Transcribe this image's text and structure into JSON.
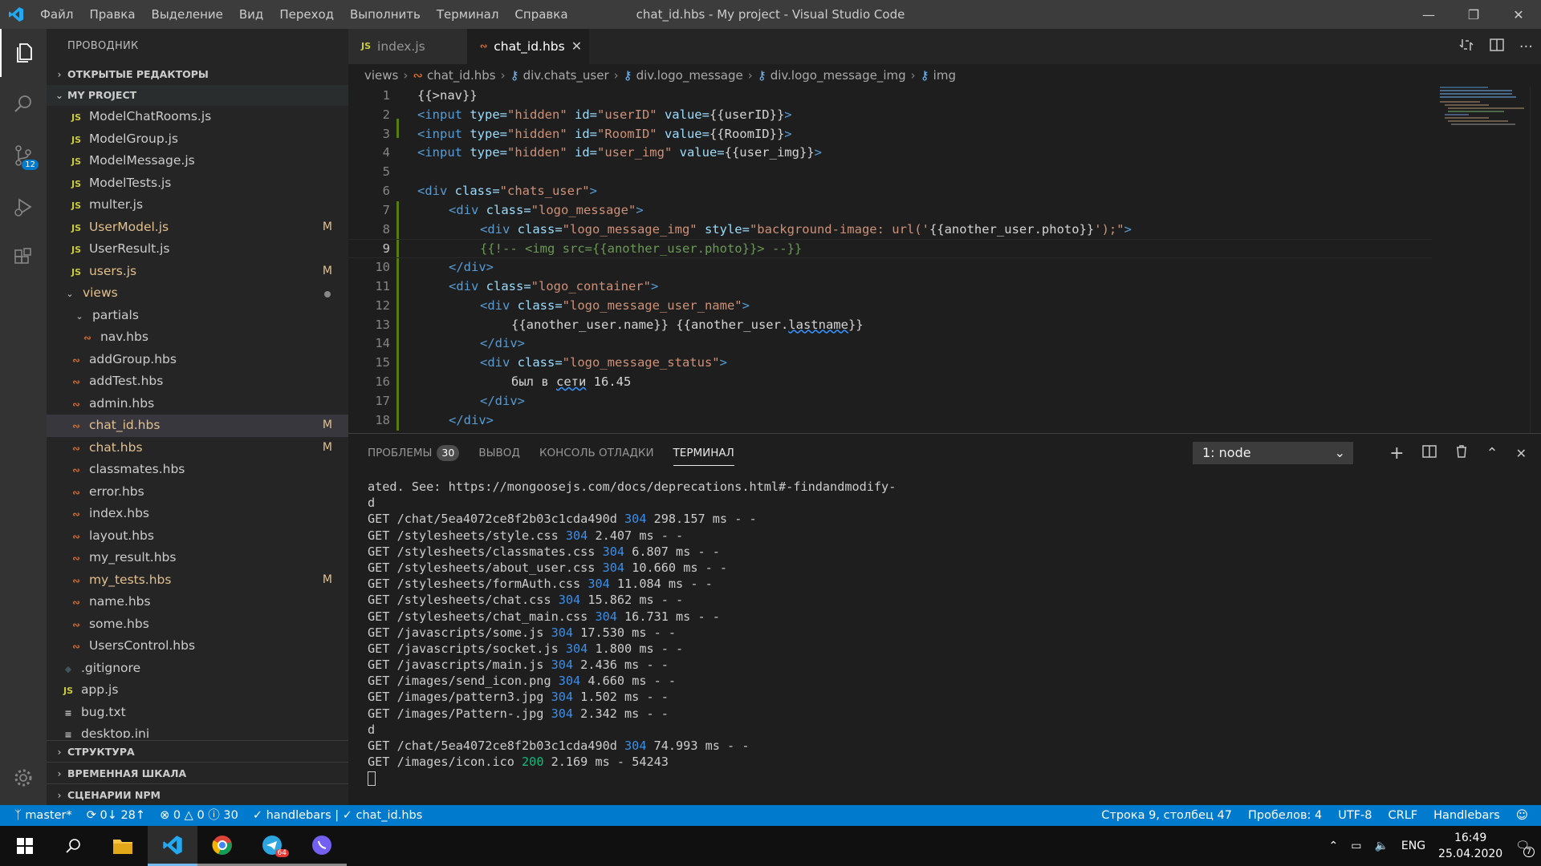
{
  "titlebar": {
    "menu": [
      "Файл",
      "Правка",
      "Выделение",
      "Вид",
      "Переход",
      "Выполнить",
      "Терминал",
      "Справка"
    ],
    "title": "chat_id.hbs - My project - Visual Studio Code"
  },
  "activitybar": {
    "scm_badge": "12"
  },
  "sidebar": {
    "title": "ПРОВОДНИК",
    "open_editors": "ОТКРЫТЫЕ РЕДАКТОРЫ",
    "project": "MY PROJECT",
    "files": [
      {
        "name": "ModelChatRooms.js",
        "icon": "JS",
        "flag": ""
      },
      {
        "name": "ModelGroup.js",
        "icon": "JS",
        "flag": ""
      },
      {
        "name": "ModelMessage.js",
        "icon": "JS",
        "flag": ""
      },
      {
        "name": "ModelTests.js",
        "icon": "JS",
        "flag": ""
      },
      {
        "name": "multer.js",
        "icon": "JS",
        "flag": ""
      },
      {
        "name": "UserModel.js",
        "icon": "JS",
        "flag": "M"
      },
      {
        "name": "UserResult.js",
        "icon": "JS",
        "flag": ""
      },
      {
        "name": "users.js",
        "icon": "JS",
        "flag": "M"
      },
      {
        "name": "views",
        "icon": "",
        "flag": ""
      },
      {
        "name": "partials",
        "icon": "",
        "flag": ""
      },
      {
        "name": "nav.hbs",
        "icon": "",
        "flag": ""
      },
      {
        "name": "addGroup.hbs",
        "icon": "",
        "flag": ""
      },
      {
        "name": "addTest.hbs",
        "icon": "",
        "flag": ""
      },
      {
        "name": "admin.hbs",
        "icon": "",
        "flag": ""
      },
      {
        "name": "chat_id.hbs",
        "icon": "",
        "flag": "M"
      },
      {
        "name": "chat.hbs",
        "icon": "",
        "flag": "M"
      },
      {
        "name": "classmates.hbs",
        "icon": "",
        "flag": ""
      },
      {
        "name": "error.hbs",
        "icon": "",
        "flag": ""
      },
      {
        "name": "index.hbs",
        "icon": "",
        "flag": ""
      },
      {
        "name": "layout.hbs",
        "icon": "",
        "flag": ""
      },
      {
        "name": "my_result.hbs",
        "icon": "",
        "flag": ""
      },
      {
        "name": "my_tests.hbs",
        "icon": "",
        "flag": "M"
      },
      {
        "name": "name.hbs",
        "icon": "",
        "flag": ""
      },
      {
        "name": "some.hbs",
        "icon": "",
        "flag": ""
      },
      {
        "name": "UsersControl.hbs",
        "icon": "",
        "flag": ""
      },
      {
        "name": ".gitignore",
        "icon": "",
        "flag": ""
      },
      {
        "name": "app.js",
        "icon": "JS",
        "flag": ""
      },
      {
        "name": "bug.txt",
        "icon": "",
        "flag": ""
      },
      {
        "name": "desktop.ini",
        "icon": "",
        "flag": ""
      }
    ],
    "sections": [
      "СТРУКТУРА",
      "ВРЕМЕННАЯ ШКАЛА",
      "СЦЕНАРИИ NPM"
    ]
  },
  "tabs": [
    {
      "label": "index.js",
      "icon": "JS"
    },
    {
      "label": "chat_id.hbs",
      "icon": ""
    }
  ],
  "breadcrumb": [
    "views",
    "chat_id.hbs",
    "div.chats_user",
    "div.logo_message",
    "div.logo_message_img",
    "img"
  ],
  "code_lines": [
    "1",
    "2",
    "3",
    "4",
    "5",
    "6",
    "7",
    "8",
    "9",
    "10",
    "11",
    "12",
    "13",
    "14",
    "15",
    "16",
    "17",
    "18"
  ],
  "code": {
    "l1": "{{>nav}}",
    "l2_tag": "<input",
    "l2_a1": " type=",
    "l2_s1": "\"hidden\"",
    "l2_a2": " id=",
    "l2_s2": "\"userID\"",
    "l2_a3": " value=",
    "l2_v": "{{userID}}",
    "l2_end": ">",
    "l3_tag": "<input",
    "l3_a1": " type=",
    "l3_s1": "\"hidden\"",
    "l3_a2": " id=",
    "l3_s2": "\"RoomID\"",
    "l3_a3": " value=",
    "l3_v": "{{RoomID}}",
    "l3_end": ">",
    "l4_tag": "<input",
    "l4_a1": " type=",
    "l4_s1": "\"hidden\"",
    "l4_a2": " id=",
    "l4_s2": "\"user_img\"",
    "l4_a3": " value=",
    "l4_v": "{{user_img}}",
    "l4_end": ">",
    "l6_tag": "<div",
    "l6_a": " class=",
    "l6_s": "\"chats_user\"",
    "l6_end": ">",
    "l7_tag": "<div",
    "l7_a": " class=",
    "l7_s": "\"logo_message\"",
    "l7_end": ">",
    "l8_tag": "<div",
    "l8_a1": " class=",
    "l8_s1": "\"logo_message_img\"",
    "l8_a2": " style=",
    "l8_s2a": "\"background-image: url('",
    "l8_v": "{{another_user.photo}}",
    "l8_s2b": "');\"",
    "l8_end": ">",
    "l9": "{{!-- <img src={{another_user.photo}}> --}}",
    "l10": "</div>",
    "l11_tag": "<div",
    "l11_a": " class=",
    "l11_s": "\"logo_container\"",
    "l11_end": ">",
    "l12_tag": "<div",
    "l12_a": " class=",
    "l12_s": "\"logo_message_user_name\"",
    "l12_end": ">",
    "l13_a": "{{another_user.name}}",
    "l13_b": " {{another_user.",
    "l13_c": "lastname",
    "l13_d": "}}",
    "l14": "</div>",
    "l15_tag": "<div",
    "l15_a": " class=",
    "l15_s": "\"logo_message_status\"",
    "l15_end": ">",
    "l16_a": "был в ",
    "l16_b": "сети",
    "l16_c": " 16.45",
    "l17": "</div>",
    "l18": "</div>"
  },
  "panel": {
    "tabs": [
      "ПРОБЛЕМЫ",
      "ВЫВОД",
      "КОНСОЛЬ ОТЛАДКИ",
      "ТЕРМИНАЛ"
    ],
    "problems_count": "30",
    "terminal_select": "1: node"
  },
  "terminal": [
    {
      "pre": "ated. See: https://mongoosejs.com/docs/deprecations.html#-findandmodify-",
      "code": "",
      "post": ""
    },
    {
      "pre": "d",
      "code": "",
      "post": ""
    },
    {
      "pre": "GET /chat/5ea4072ce8f2b03c1cda490d ",
      "code": "304",
      "post": " 298.157 ms - -"
    },
    {
      "pre": "GET /stylesheets/style.css ",
      "code": "304",
      "post": " 2.407 ms - -"
    },
    {
      "pre": "GET /stylesheets/classmates.css ",
      "code": "304",
      "post": " 6.807 ms - -"
    },
    {
      "pre": "GET /stylesheets/about_user.css ",
      "code": "304",
      "post": " 10.660 ms - -"
    },
    {
      "pre": "GET /stylesheets/formAuth.css ",
      "code": "304",
      "post": " 11.084 ms - -"
    },
    {
      "pre": "GET /stylesheets/chat.css ",
      "code": "304",
      "post": " 15.862 ms - -"
    },
    {
      "pre": "GET /stylesheets/chat_main.css ",
      "code": "304",
      "post": " 16.731 ms - -"
    },
    {
      "pre": "GET /javascripts/some.js ",
      "code": "304",
      "post": " 17.530 ms - -"
    },
    {
      "pre": "GET /javascripts/socket.js ",
      "code": "304",
      "post": " 1.800 ms - -"
    },
    {
      "pre": "GET /javascripts/main.js ",
      "code": "304",
      "post": " 2.436 ms - -"
    },
    {
      "pre": "GET /images/send_icon.png ",
      "code": "304",
      "post": " 4.660 ms - -"
    },
    {
      "pre": "GET /images/pattern3.jpg ",
      "code": "304",
      "post": " 1.502 ms - -"
    },
    {
      "pre": "GET /images/Pattern-.jpg ",
      "code": "304",
      "post": " 2.342 ms - -"
    },
    {
      "pre": "d",
      "code": "",
      "post": ""
    },
    {
      "pre": "GET /chat/5ea4072ce8f2b03c1cda490d ",
      "code": "304",
      "post": " 74.993 ms - -"
    },
    {
      "pre": "GET /images/icon.ico ",
      "code": "200",
      "post": " 2.169 ms - 54243"
    }
  ],
  "statusbar": {
    "branch": "master*",
    "sync": "0↓ 28↑",
    "errors": "0",
    "warnings": "0",
    "infos": "30",
    "lint": "handlebars | ✓ chat_id.hbs",
    "position": "Строка 9, столбец 47",
    "spaces": "Пробелов: 4",
    "encoding": "UTF-8",
    "eol": "CRLF",
    "language": "Handlebars"
  },
  "taskbar": {
    "telegram_badge": "64",
    "lang": "ENG",
    "time": "16:49",
    "date": "25.04.2020",
    "notif_count": "7"
  },
  "colors": {
    "accent": "#007acc",
    "modified": "#e2c08d"
  }
}
